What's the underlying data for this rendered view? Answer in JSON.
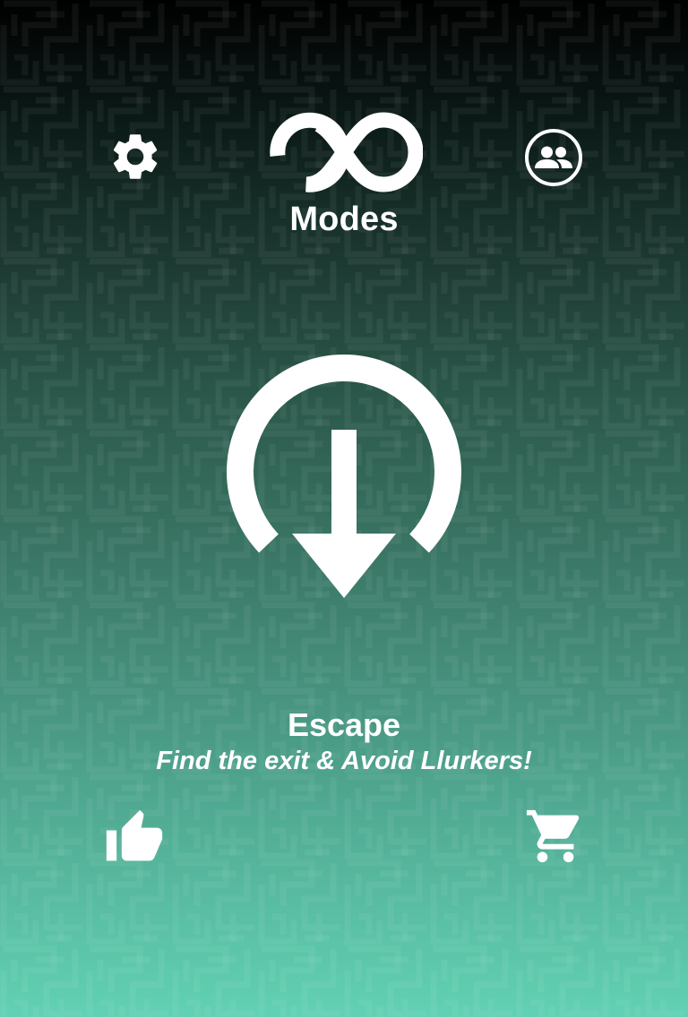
{
  "top_bar": {
    "settings_icon": "gear-icon",
    "modes_icon": "infinity-icon",
    "modes_label": "Modes",
    "friends_icon": "people-circle-icon"
  },
  "mode": {
    "icon": "exit-arrow-down-icon",
    "title": "Escape",
    "subtitle": "Find the exit & Avoid Llurkers!"
  },
  "bottom_bar": {
    "like_icon": "thumbs-up-icon",
    "shop_icon": "shopping-cart-icon"
  },
  "colors": {
    "background_top": "#000000",
    "background_bottom": "#62d1b3",
    "foreground": "#ffffff"
  }
}
